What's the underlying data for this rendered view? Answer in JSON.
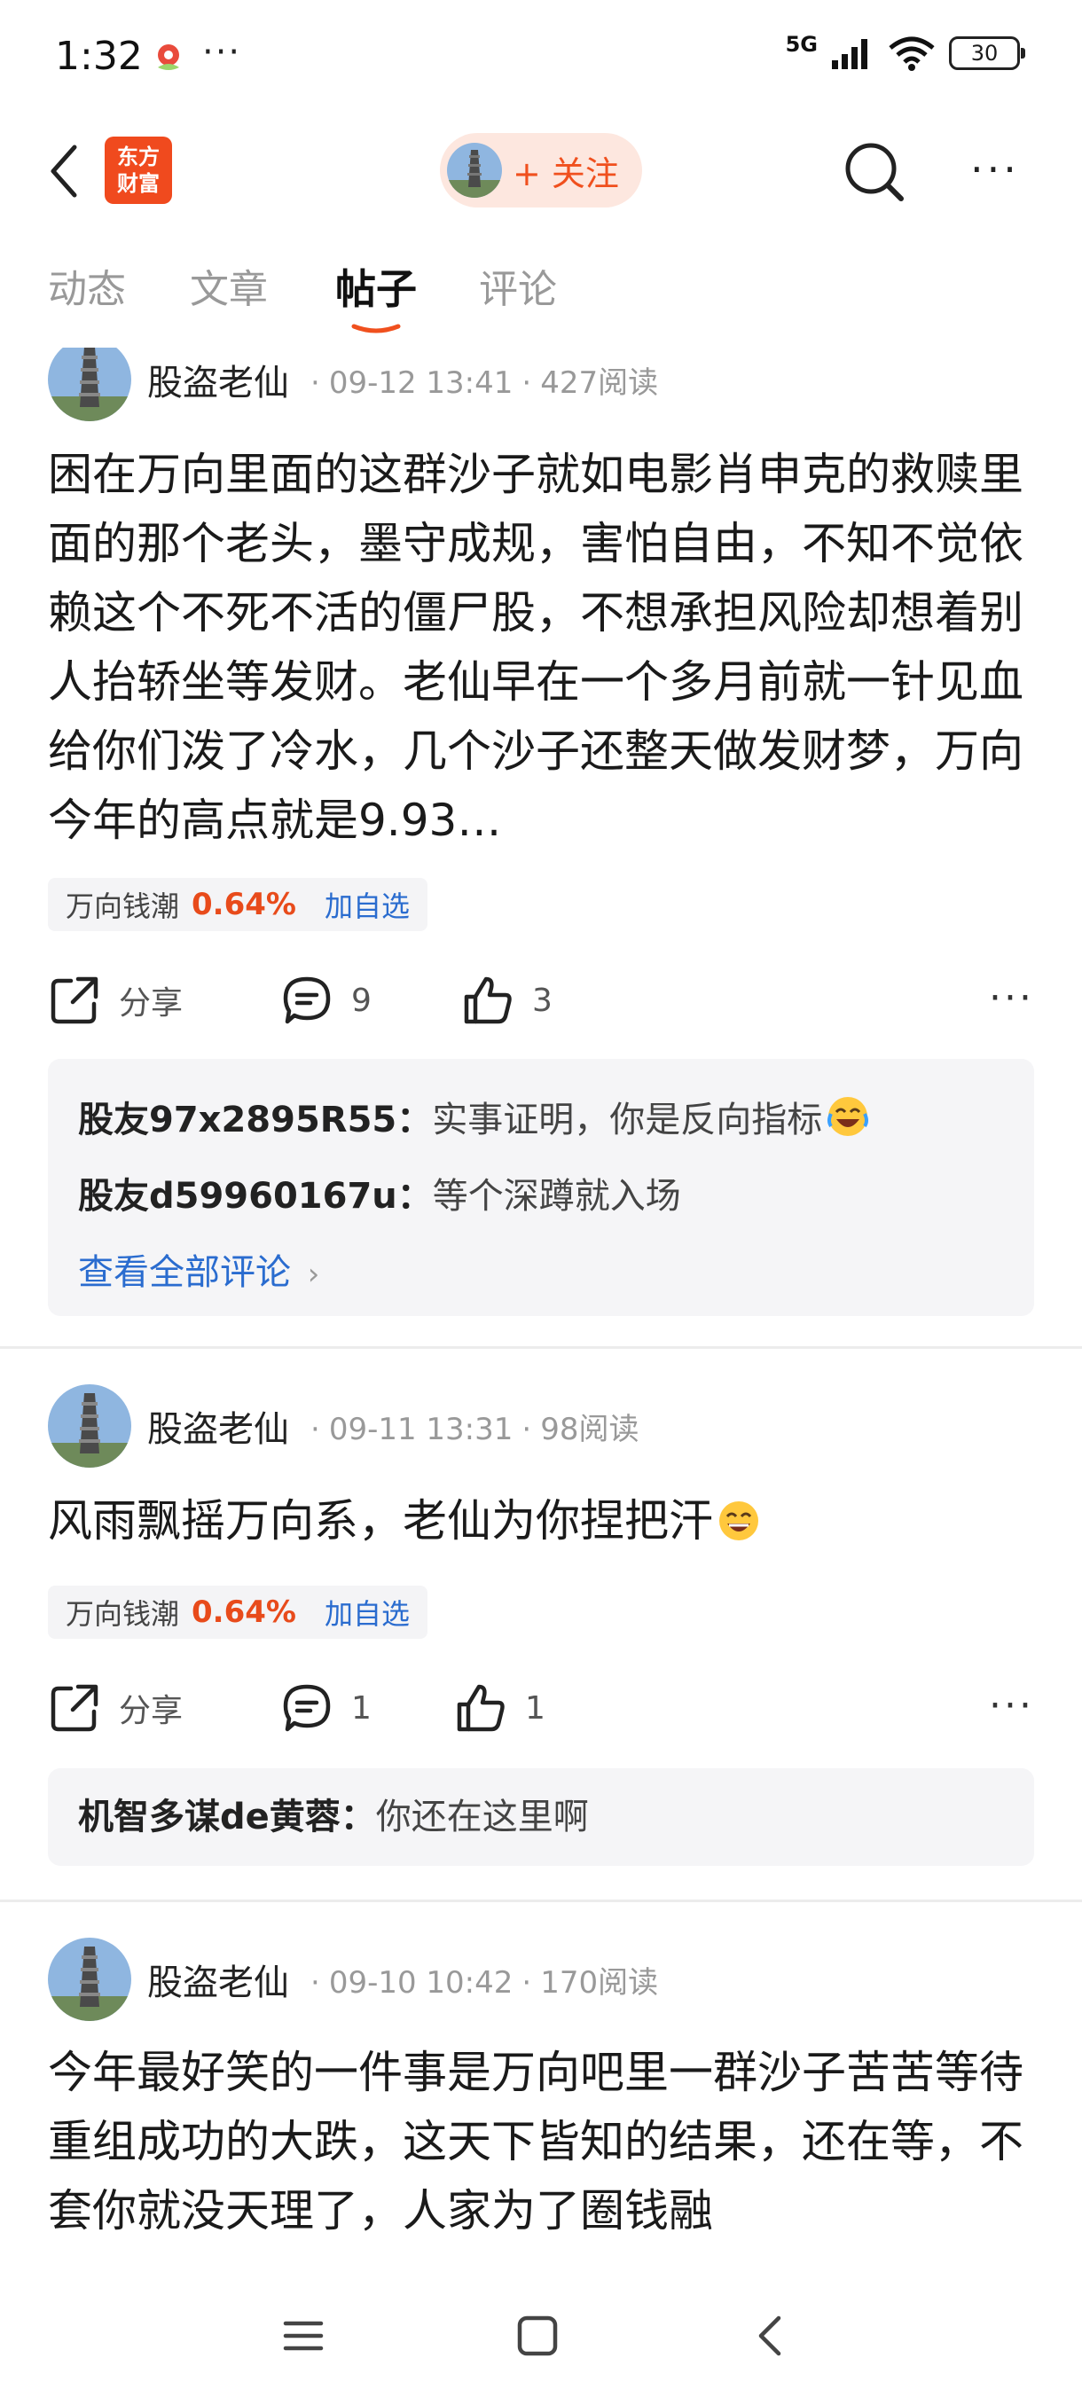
{
  "status_bar": {
    "time": "1:32",
    "network": "5G",
    "battery": "30"
  },
  "header": {
    "logo_line1": "东方",
    "logo_line2": "财富",
    "follow_label": "+ 关注"
  },
  "tabs": [
    {
      "label": "动态",
      "active": false
    },
    {
      "label": "文章",
      "active": false
    },
    {
      "label": "帖子",
      "active": true
    },
    {
      "label": "评论",
      "active": false
    }
  ],
  "posts": [
    {
      "author": "股盗老仙",
      "time": "09-12 13:41",
      "reads": "427阅读",
      "body": "困在万向里面的这群沙子就如电影肖申克的救赎里面的那个老头，墨守成规，害怕自由，不知不觉依赖这个不死不活的僵尸股，不想承担风险却想着别人抬轿坐等发财。老仙早在一个多月前就一针见血给你们泼了冷水，几个沙子还整天做发财梦，万向今年的高点就是9.93…",
      "stock": {
        "name": "万向钱潮",
        "change": "0.64%",
        "add_label": "加自选"
      },
      "share_label": "分享",
      "comment_count": "9",
      "like_count": "3",
      "comments": [
        {
          "user": "股友97x2895R55：",
          "text": "实事证明，你是反向指标",
          "emoji": "laugh-cry"
        },
        {
          "user": "股友d59960167u：",
          "text": "等个深蹲就入场"
        }
      ],
      "view_all": "查看全部评论"
    },
    {
      "author": "股盗老仙",
      "time": "09-11 13:31",
      "reads": "98阅读",
      "body": "风雨飘摇万向系，老仙为你捏把汗",
      "stock": {
        "name": "万向钱潮",
        "change": "0.64%",
        "add_label": "加自选"
      },
      "share_label": "分享",
      "comment_count": "1",
      "like_count": "1",
      "comments": [
        {
          "user": "机智多谋de黄蓉：",
          "text": "你还在这里啊"
        }
      ]
    },
    {
      "author": "股盗老仙",
      "time": "09-10 10:42",
      "reads": "170阅读",
      "body": "今年最好笑的一件事是万向吧里一群沙子苦苦等待重组成功的大跌，这天下皆知的结果，还在等，不套你就没天理了，人家为了圈钱融"
    }
  ],
  "colors": {
    "accent": "#f0501e",
    "up_red": "#e84b1b",
    "link_blue": "#2a6ccf"
  }
}
